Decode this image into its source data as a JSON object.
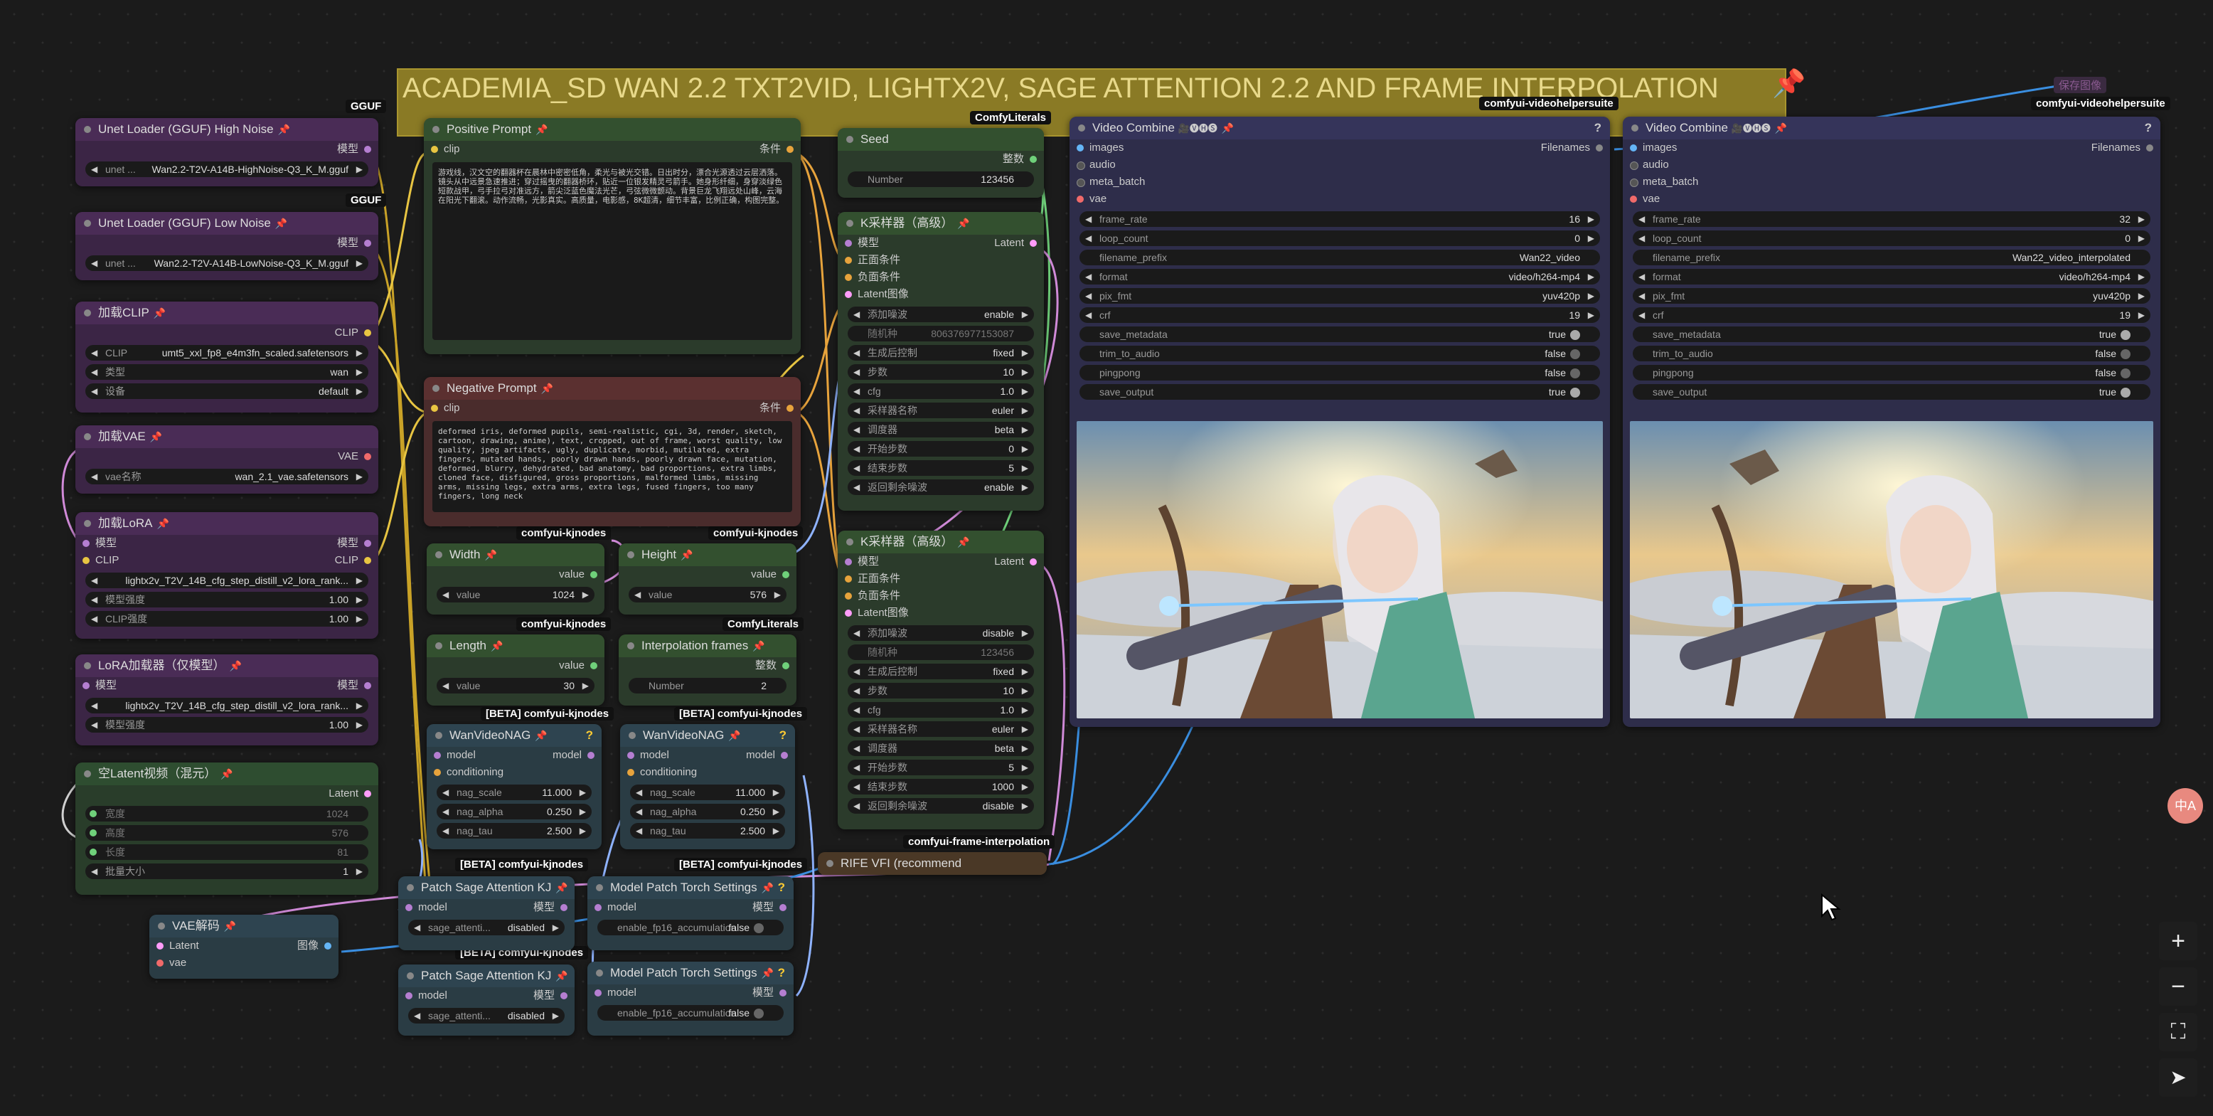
{
  "group": {
    "title": "ACADEMIA_SD WAN 2.2 TXT2VID, LIGHTX2V, SAGE ATTENTION 2.2 AND FRAME INTERPOLATION"
  },
  "hidden_node": {
    "label": "保存图像"
  },
  "badges": {
    "gguf1": "GGUF",
    "gguf2": "GGUF",
    "literals1": "ComfyLiterals",
    "literals2": "ComfyLiterals",
    "kj1": "comfyui-kjnodes",
    "kj2": "comfyui-kjnodes",
    "kj3": "comfyui-kjnodes",
    "beta1": "[BETA] comfyui-kjnodes",
    "beta2": "[BETA] comfyui-kjnodes",
    "beta3": "[BETA] comfyui-kjnodes",
    "beta4": "[BETA] comfyui-kjnodes",
    "beta5": "[BETA] comfyui-kjnodes",
    "vhs1": "comfyui-videohelpersuite",
    "vhs2": "comfyui-videohelpersuite",
    "fi": "comfyui-frame-interpolation"
  },
  "unet_high": {
    "title": "Unet Loader (GGUF) High Noise",
    "out": "模型",
    "w_label": "unet ...",
    "w_value": "Wan2.2-T2V-A14B-HighNoise-Q3_K_M.gguf"
  },
  "unet_low": {
    "title": "Unet Loader (GGUF) Low Noise",
    "out": "模型",
    "w_label": "unet ...",
    "w_value": "Wan2.2-T2V-A14B-LowNoise-Q3_K_M.gguf"
  },
  "clip_loader": {
    "title": "加载CLIP",
    "out": "CLIP",
    "rows": [
      [
        "CLIP",
        "umt5_xxl_fp8_e4m3fn_scaled.safetensors"
      ],
      [
        "类型",
        "wan"
      ],
      [
        "设备",
        "default"
      ]
    ]
  },
  "vae_loader": {
    "title": "加载VAE",
    "out": "VAE",
    "w_label": "vae名称",
    "w_value": "wan_2.1_vae.safetensors"
  },
  "lora1": {
    "title": "加载LoRA",
    "in1": "模型",
    "in2": "CLIP",
    "out1": "模型",
    "out2": "CLIP",
    "rows": [
      [
        "",
        "lightx2v_T2V_14B_cfg_step_distill_v2_lora_rank..."
      ],
      [
        "模型强度",
        "1.00"
      ],
      [
        "CLIP强度",
        "1.00"
      ]
    ]
  },
  "lora2": {
    "title": "LoRA加载器（仅模型）",
    "in1": "模型",
    "out1": "模型",
    "rows": [
      [
        "",
        "lightx2v_T2V_14B_cfg_step_distill_v2_lora_rank..."
      ],
      [
        "模型强度",
        "1.00"
      ]
    ]
  },
  "latent": {
    "title": "空Latent视频（混元）",
    "out": "Latent",
    "rows": [
      [
        "宽度",
        "1024"
      ],
      [
        "高度",
        "576"
      ],
      [
        "长度",
        "81"
      ],
      [
        "批量大小",
        "1"
      ]
    ]
  },
  "vae_decode": {
    "title": "VAE解码",
    "in1": "Latent",
    "in2": "vae",
    "out": "图像"
  },
  "pos": {
    "title": "Positive Prompt",
    "in": "clip",
    "out": "条件",
    "text": "游戏线，汉文空的翻器杯在晨林中密密低角，柔光与被光交错。日出时分，漂合光源透过云层洒落。镜头从中远景急速推进；穿过摇曳的翻器桥环，贴近一位银发精灵弓箭手。她身形纤细，身穿淡绿色短款战甲，弓手拉弓对准远方，箭尖泛蓝色魔法光芒，弓弦微微颤动。背景巨龙飞翔远处山峰，云海在阳光下翻滚。动作流畅，光影真实。高质量，电影感，8K超清，细节丰富，比例正确，构图完整。"
  },
  "neg": {
    "title": "Negative Prompt",
    "in": "clip",
    "out": "条件",
    "text": "deformed iris, deformed pupils, semi-realistic, cgi, 3d, render, sketch, cartoon, drawing, anime), text, cropped, out of frame, worst quality, low quality, jpeg artifacts, ugly, duplicate, morbid, mutilated, extra fingers, mutated hands, poorly drawn hands, poorly drawn face, mutation, deformed, blurry, dehydrated, bad anatomy, bad proportions, extra limbs, cloned face, disfigured, gross proportions, malformed limbs, missing arms, missing legs, extra arms, extra legs, fused fingers, too many fingers, long neck"
  },
  "width": {
    "title": "Width",
    "out": "value",
    "w_label": "value",
    "w_value": "1024"
  },
  "height": {
    "title": "Height",
    "out": "value",
    "w_label": "value",
    "w_value": "576"
  },
  "length": {
    "title": "Length",
    "out": "value",
    "w_label": "value",
    "w_value": "30"
  },
  "interp": {
    "title": "Interpolation frames",
    "out": "整数",
    "w_label": "Number",
    "w_value": "2"
  },
  "nag1": {
    "title": "WanVideoNAG",
    "in1": "model",
    "in2": "conditioning",
    "out": "model",
    "rows": [
      [
        "nag_scale",
        "11.000"
      ],
      [
        "nag_alpha",
        "0.250"
      ],
      [
        "nag_tau",
        "2.500"
      ]
    ]
  },
  "nag2": {
    "title": "WanVideoNAG",
    "in1": "model",
    "in2": "conditioning",
    "out": "model",
    "rows": [
      [
        "nag_scale",
        "11.000"
      ],
      [
        "nag_alpha",
        "0.250"
      ],
      [
        "nag_tau",
        "2.500"
      ]
    ]
  },
  "seed": {
    "title": "Seed",
    "out": "整数",
    "w_label": "Number",
    "w_value": "123456"
  },
  "ks1": {
    "title": "K采样器（高级）",
    "out": "Latent",
    "ins": [
      "模型",
      "正面条件",
      "负面条件",
      "Latent图像"
    ],
    "rows": [
      [
        "添加噪波",
        "enable"
      ],
      [
        "随机种",
        "806376977153087"
      ],
      [
        "生成后控制",
        "fixed"
      ],
      [
        "步数",
        "10"
      ],
      [
        "cfg",
        "1.0"
      ],
      [
        "采样器名称",
        "euler"
      ],
      [
        "调度器",
        "beta"
      ],
      [
        "开始步数",
        "0"
      ],
      [
        "结束步数",
        "5"
      ],
      [
        "返回剩余噪波",
        "enable"
      ]
    ]
  },
  "ks2": {
    "title": "K采样器（高级）",
    "out": "Latent",
    "ins": [
      "模型",
      "正面条件",
      "负面条件",
      "Latent图像"
    ],
    "rows": [
      [
        "添加噪波",
        "disable"
      ],
      [
        "随机种",
        "123456"
      ],
      [
        "生成后控制",
        "fixed"
      ],
      [
        "步数",
        "10"
      ],
      [
        "cfg",
        "1.0"
      ],
      [
        "采样器名称",
        "euler"
      ],
      [
        "调度器",
        "beta"
      ],
      [
        "开始步数",
        "5"
      ],
      [
        "结束步数",
        "1000"
      ],
      [
        "返回剩余噪波",
        "disable"
      ]
    ]
  },
  "rife": {
    "title": "RIFE VFI (recommend"
  },
  "sage1": {
    "title": "Patch Sage Attention KJ",
    "in": "model",
    "out": "模型",
    "w_label": "sage_attenti...",
    "w_value": "disabled"
  },
  "sage2": {
    "title": "Patch Sage Attention KJ",
    "in": "model",
    "out": "模型",
    "w_label": "sage_attenti...",
    "w_value": "disabled"
  },
  "mpt1": {
    "title": "Model Patch Torch Settings",
    "in": "model",
    "out": "模型",
    "w_label": "enable_fp16_accumulation",
    "w_value": "false"
  },
  "mpt2": {
    "title": "Model Patch Torch Settings",
    "in": "model",
    "out": "模型",
    "w_label": "enable_fp16_accumulation",
    "w_value": "false"
  },
  "vc1": {
    "title": "Video Combine",
    "icons": "🎥🅥🅗🅢",
    "ins": [
      "images",
      "audio",
      "meta_batch",
      "vae"
    ],
    "out": "Filenames",
    "rows": [
      [
        "frame_rate",
        "16"
      ],
      [
        "loop_count",
        "0"
      ],
      [
        "filename_prefix",
        "Wan22_video"
      ],
      [
        "format",
        "video/h264-mp4"
      ],
      [
        "pix_fmt",
        "yuv420p"
      ],
      [
        "crf",
        "19"
      ]
    ],
    "toggles": [
      [
        "save_metadata",
        "true"
      ],
      [
        "trim_to_audio",
        "false"
      ],
      [
        "pingpong",
        "false"
      ],
      [
        "save_output",
        "true"
      ]
    ]
  },
  "vc2": {
    "title": "Video Combine",
    "icons": "🎥🅥🅗🅢",
    "ins": [
      "images",
      "audio",
      "meta_batch",
      "vae"
    ],
    "out": "Filenames",
    "rows": [
      [
        "frame_rate",
        "32"
      ],
      [
        "loop_count",
        "0"
      ],
      [
        "filename_prefix",
        "Wan22_video_interpolated"
      ],
      [
        "format",
        "video/h264-mp4"
      ],
      [
        "pix_fmt",
        "yuv420p"
      ],
      [
        "crf",
        "19"
      ]
    ],
    "toggles": [
      [
        "save_metadata",
        "true"
      ],
      [
        "trim_to_audio",
        "false"
      ],
      [
        "pingpong",
        "false"
      ],
      [
        "save_output",
        "true"
      ]
    ]
  },
  "side": {
    "lang": "中A"
  },
  "controls": {
    "zoom_in": "+",
    "zoom_out": "−",
    "fit": "⛶",
    "locate": "➤"
  }
}
